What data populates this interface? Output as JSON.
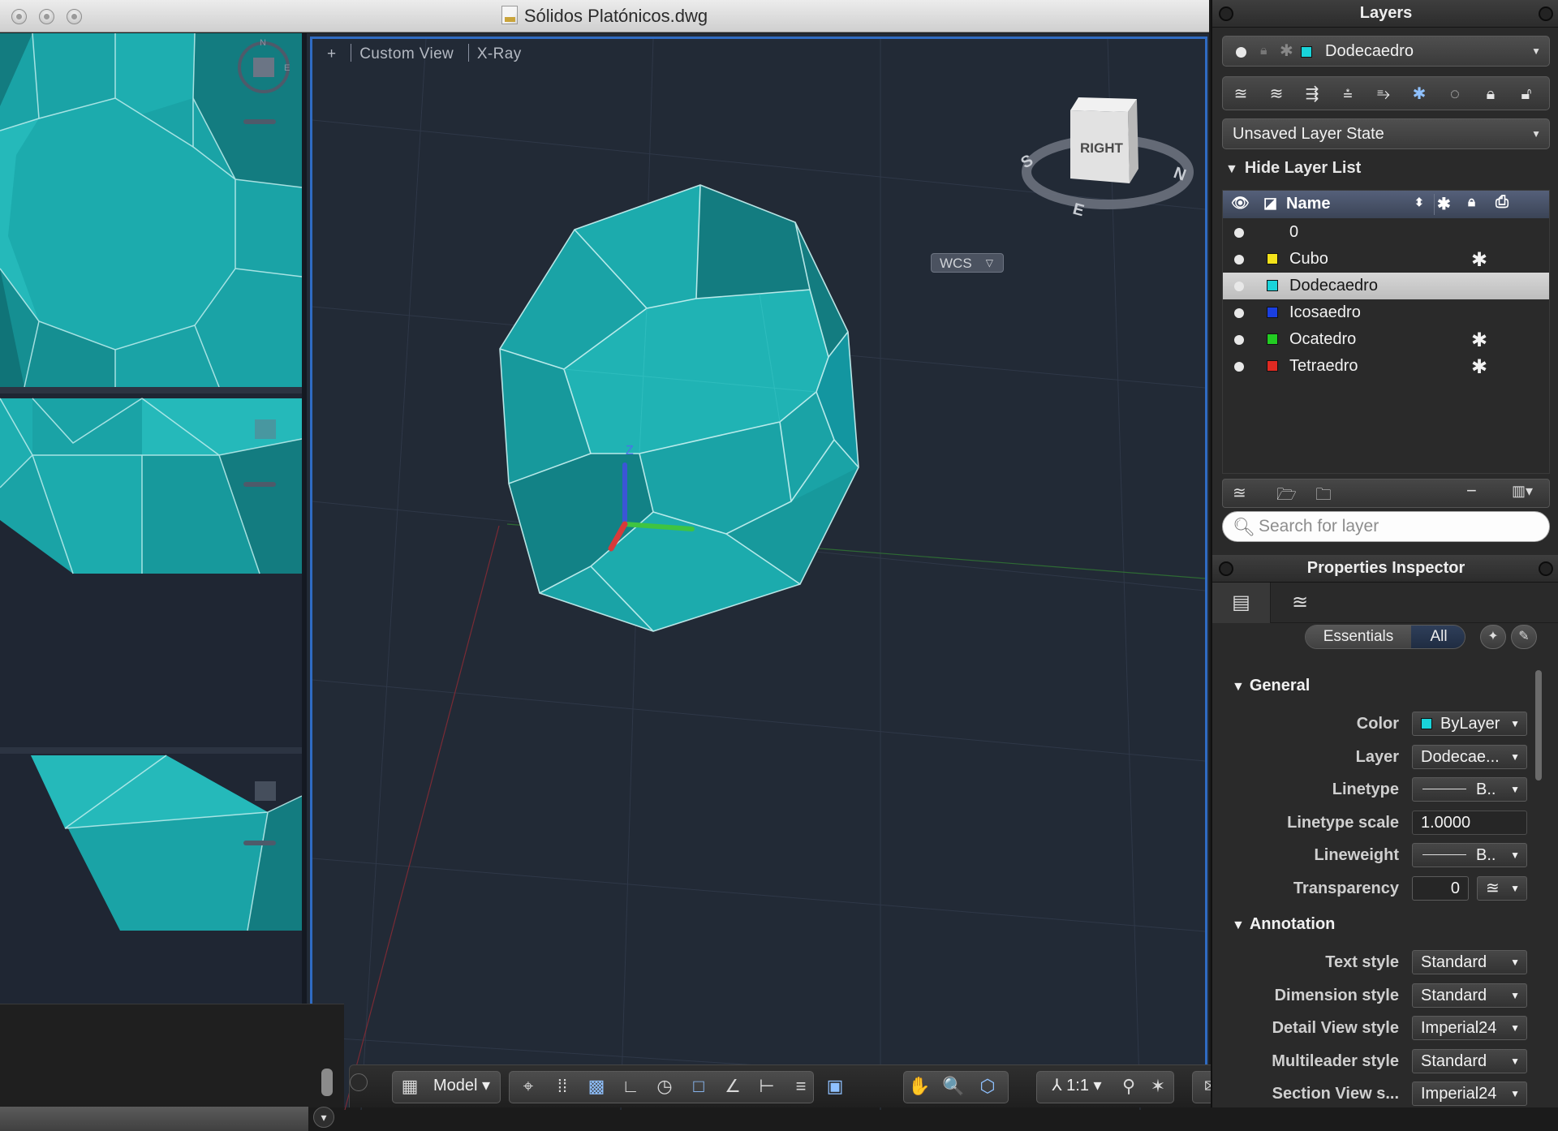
{
  "window": {
    "title": "Sólidos Platónicos.dwg"
  },
  "viewport": {
    "controls": [
      "+",
      "Custom View",
      "X-Ray"
    ],
    "wcs_label": "WCS",
    "viewcube_face": "RIGHT",
    "compass": [
      "S",
      "E",
      "N"
    ]
  },
  "status_bar": {
    "model_label": "Model",
    "scale_label": "1:1"
  },
  "layers_palette": {
    "title": "Layers",
    "current_layer": "Dodecaedro",
    "layer_state": "Unsaved Layer State",
    "hide_list_label": "Hide Layer List",
    "column_name": "Name",
    "rows": [
      {
        "name": "0",
        "color": "",
        "frozen_icon": false,
        "selected": false
      },
      {
        "name": "Cubo",
        "color": "#f3e21a",
        "frozen_icon": true,
        "selected": false
      },
      {
        "name": "Dodecaedro",
        "color": "#19d3d9",
        "frozen_icon": false,
        "selected": true
      },
      {
        "name": "Icosaedro",
        "color": "#1a3fe0",
        "frozen_icon": false,
        "selected": false
      },
      {
        "name": "Ocatedro",
        "color": "#22cc22",
        "frozen_icon": true,
        "selected": false
      },
      {
        "name": "Tetraedro",
        "color": "#e02a22",
        "frozen_icon": true,
        "selected": false
      }
    ],
    "search_placeholder": "Search for layer"
  },
  "properties_inspector": {
    "title": "Properties Inspector",
    "segment_essentials": "Essentials",
    "segment_all": "All",
    "general_header": "General",
    "general": [
      {
        "label": "Color",
        "value": "ByLayer"
      },
      {
        "label": "Layer",
        "value": "Dodecae..."
      },
      {
        "label": "Linetype",
        "value": "B.."
      },
      {
        "label": "Linetype scale",
        "value": "1.0000"
      },
      {
        "label": "Lineweight",
        "value": "B.."
      },
      {
        "label": "Transparency",
        "value": "0"
      }
    ],
    "annotation_header": "Annotation",
    "annotation": [
      {
        "label": "Text style",
        "value": "Standard"
      },
      {
        "label": "Dimension style",
        "value": "Standard"
      },
      {
        "label": "Detail View style",
        "value": "Imperial24"
      },
      {
        "label": "Multileader style",
        "value": "Standard"
      },
      {
        "label": "Section View s...",
        "value": "Imperial24"
      }
    ]
  },
  "colors": {
    "teal_face": "#1aa3a6",
    "teal_dark": "#137c80",
    "teal_light": "#23b6b7",
    "canvas": "#222a36",
    "viewport_border": "#2f6bc2",
    "selected_layer": "#19d3d9"
  }
}
